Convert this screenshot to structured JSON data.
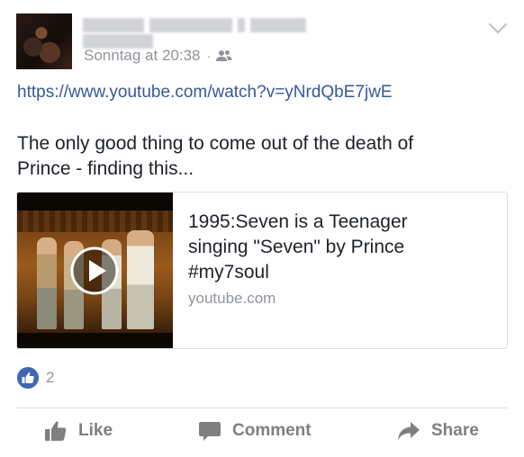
{
  "post": {
    "timestamp": "Sonntag at 20:38",
    "separator": "·",
    "audience_icon": "friends-icon",
    "link_url": "https://www.youtube.com/watch?v=yNrdQbE7jwE",
    "text_line1": "The only good thing to come out of the death of",
    "text_line2": "Prince - finding this..."
  },
  "link_card": {
    "title_line1": "1995:Seven is a Teenager",
    "title_line2": "singing \"Seven\" by Prince",
    "title_line3": "#my7soul",
    "domain": "youtube.com",
    "thumbnail_icon": "play-icon"
  },
  "reactions": {
    "icon": "like-reaction-icon",
    "count": "2"
  },
  "actions": {
    "like_label": "Like",
    "comment_label": "Comment",
    "share_label": "Share"
  },
  "colors": {
    "link": "#365899",
    "muted": "#90949c",
    "like_blue": "#4267b2",
    "text": "#1d2129"
  }
}
